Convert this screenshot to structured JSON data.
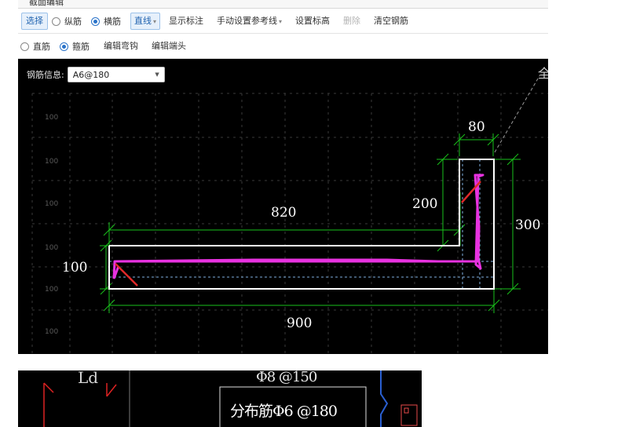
{
  "window": {
    "title": "截面编辑"
  },
  "toolbar1": {
    "select_label": "选择",
    "radio_longitudinal": "纵筋",
    "radio_transverse": "横筋",
    "line_mode": "直线",
    "show_dims": "显示标注",
    "manual_ref": "手动设置参考线",
    "set_elev": "设置标高",
    "delete": "删除",
    "clear": "清空钢筋"
  },
  "toolbar2": {
    "radio_straight": "直筋",
    "radio_stirrup": "箍筋",
    "edit_hook": "编辑弯钩",
    "edit_end": "编辑端头"
  },
  "canvas": {
    "rebar_info_label": "钢筋信息:",
    "rebar_info_value": "A6@180",
    "grid_labels": [
      "100",
      "100",
      "100",
      "100",
      "100",
      "100"
    ],
    "dims": {
      "d80": "80",
      "d200": "200",
      "d820": "820",
      "d300": "300",
      "d100": "100",
      "d900": "900"
    },
    "colors": {
      "background": "#000000",
      "dimension_line": "#19c21b",
      "section_outline": "#ffffff",
      "rebar": "#e832e0",
      "hook": "#e12a2a"
    }
  },
  "cad2": {
    "fragment": "Ld",
    "label_top": "Φ8 @150",
    "label_dist": "分布筋Φ6 @180"
  }
}
